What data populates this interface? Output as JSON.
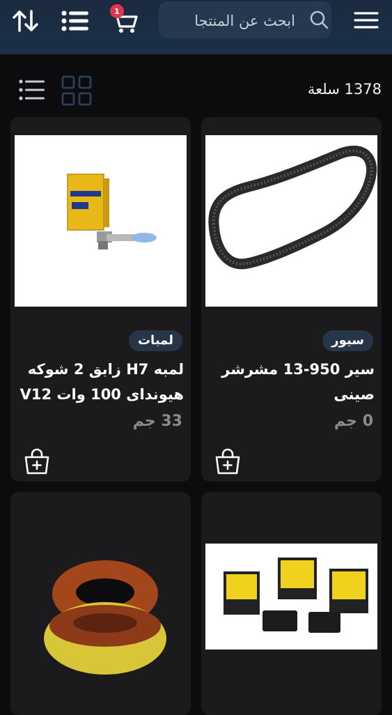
{
  "header": {
    "search_placeholder": "ابحث عن المنتجا",
    "cart_count": "1",
    "icons": [
      "sort-icon",
      "list-icon",
      "cart-icon",
      "search-icon",
      "menu-icon"
    ]
  },
  "toolbar": {
    "items_count": "1378 سلعة",
    "icons": [
      "grid-view-icon",
      "list-view-icon"
    ]
  },
  "products": [
    {
      "category": "سيور",
      "title": "سير 950-13 مشرشر صينى",
      "price": "0 جم",
      "image": "timing-belt"
    },
    {
      "category": "لمبات",
      "title": "لمبه H7 زابق 2 شوكه هيونداى 100 وات V12",
      "price": "33 جم",
      "image": "h7-bulb"
    },
    {
      "image": "window-switches"
    },
    {
      "image": "wire-coils"
    }
  ],
  "colors": {
    "header_bg": "#1a2c44",
    "search_bg": "#26384f",
    "card_bg": "#1b1b1d",
    "badge_bg": "#263548",
    "badge_count_bg": "#e0354a",
    "page_bg": "#0c0c0e"
  }
}
